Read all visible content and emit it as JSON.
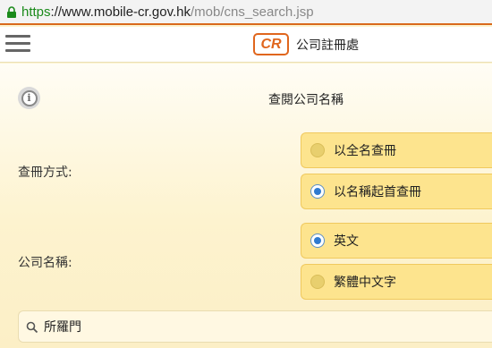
{
  "browser": {
    "url_scheme": "https",
    "url_host": "://www.mobile-cr.gov.hk",
    "url_path": "/mob/cns_search.jsp"
  },
  "header": {
    "menu_icon": "hamburger-icon",
    "logo_text": "CR",
    "brand_name": "公司註冊處"
  },
  "page": {
    "title": "查閱公司名稱",
    "info_icon": "info-icon"
  },
  "search_method": {
    "label": "查冊方式:",
    "options": [
      {
        "label": "以全名查冊",
        "selected": false
      },
      {
        "label": "以名稱起首查冊",
        "selected": true
      }
    ]
  },
  "company_name": {
    "label": "公司名稱:",
    "options": [
      {
        "label": "英文",
        "selected": true
      },
      {
        "label": "繁體中文字",
        "selected": false
      }
    ]
  },
  "search": {
    "value": "所羅門",
    "icon": "search-icon"
  },
  "colors": {
    "accent": "#e0661d",
    "option_bg": "#fde48e",
    "radio_selected": "#2f7bd0"
  }
}
